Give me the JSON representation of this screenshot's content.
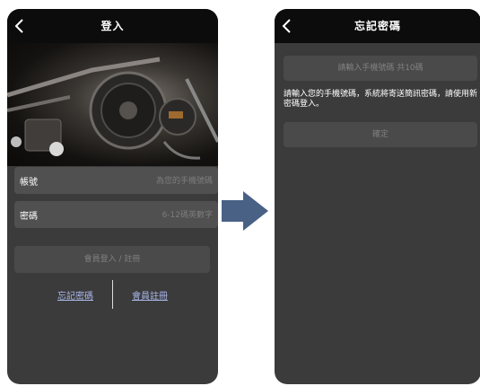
{
  "colors": {
    "screen_bg": "#3b3b3b",
    "topbar": "#0c0c0c",
    "field": "#505050",
    "button": "#4a4a4a",
    "link": "#aab6ea",
    "arrow": "#4a6186"
  },
  "login": {
    "title": "登入",
    "back_icon": "chevron-left-icon",
    "hero_image": "motorcycle-engine-photo",
    "account": {
      "label": "帳號",
      "placeholder": "為您的手機號碼"
    },
    "password": {
      "label": "密碼",
      "placeholder": "6-12碼英數字"
    },
    "submit_label": "會員登入 / 註冊",
    "forgot_link": "忘記密碼",
    "register_link": "會員註冊"
  },
  "transition_icon": "right-arrow-icon",
  "forgot": {
    "title": "忘記密碼",
    "back_icon": "chevron-left-icon",
    "phone_placeholder": "請輸入手機號碼 共10碼",
    "description": "請輸入您的手機號碼，系統將寄送簡訊密碼，請使用新密碼登入。",
    "confirm_label": "確定"
  }
}
